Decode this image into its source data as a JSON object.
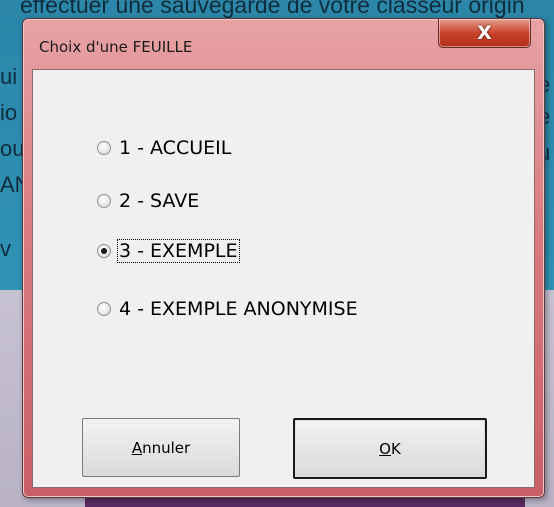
{
  "background": {
    "top_text": "effectuer une sauvegarde de votre classeur origin",
    "left_fragments": [
      "ui",
      "io",
      "ou",
      "AN",
      "v"
    ],
    "right_fragments": [
      "e",
      "e",
      "u"
    ]
  },
  "dialog": {
    "title": "Choix d'une FEUILLE",
    "close_label": "X",
    "options": [
      {
        "label": "1 - ACCUEIL",
        "checked": false
      },
      {
        "label": "2 - SAVE",
        "checked": false
      },
      {
        "label": "3 - EXEMPLE",
        "checked": true
      },
      {
        "label": "4 - EXEMPLE ANONYMISE",
        "checked": false
      }
    ],
    "cancel": {
      "mnemonic": "A",
      "rest": "nnuler"
    },
    "ok": {
      "mnemonic": "O",
      "rest": "K"
    }
  }
}
